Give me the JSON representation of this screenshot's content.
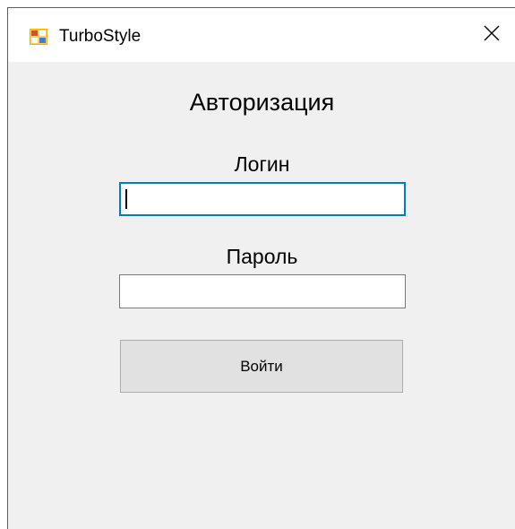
{
  "window": {
    "title": "TurboStyle",
    "icon": "app-form-icon",
    "close_icon": "close-icon"
  },
  "form": {
    "heading": "Авторизация",
    "login_label": "Логин",
    "login_value": "",
    "password_label": "Пароль",
    "password_value": "",
    "submit_label": "Войти"
  },
  "colors": {
    "focus_border": "#0078d7",
    "client_background": "#f0f0f0",
    "button_background": "#e1e1e1"
  }
}
